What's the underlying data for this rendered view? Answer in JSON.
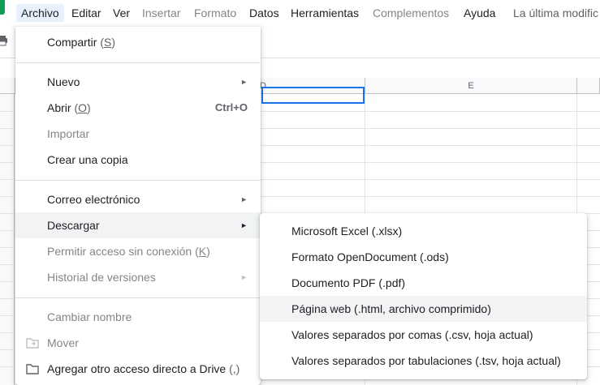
{
  "menubar": {
    "items": [
      {
        "label": "Archivo",
        "state": "active"
      },
      {
        "label": "Editar",
        "state": "normal"
      },
      {
        "label": "Ver",
        "state": "normal"
      },
      {
        "label": "Insertar",
        "state": "disabled"
      },
      {
        "label": "Formato",
        "state": "disabled"
      },
      {
        "label": "Datos",
        "state": "normal"
      },
      {
        "label": "Herramientas",
        "state": "normal"
      },
      {
        "label": "Complementos",
        "state": "disabled"
      },
      {
        "label": "Ayuda",
        "state": "normal"
      }
    ],
    "last_edit": "La última modific"
  },
  "grid": {
    "columns": [
      "D",
      "E"
    ]
  },
  "file_menu": {
    "share": {
      "label": "Compartir",
      "key": "S"
    },
    "new": {
      "label": "Nuevo"
    },
    "open": {
      "label": "Abrir",
      "key": "O",
      "shortcut": "Ctrl+O"
    },
    "import": {
      "label": "Importar"
    },
    "copy": {
      "label": "Crear una copia"
    },
    "email": {
      "label": "Correo electrónico"
    },
    "download": {
      "label": "Descargar"
    },
    "offline": {
      "label": "Permitir acceso sin conexión",
      "key": "K"
    },
    "history": {
      "label": "Historial de versiones"
    },
    "rename": {
      "label": "Cambiar nombre"
    },
    "move": {
      "label": "Mover"
    },
    "shortcut_drive": {
      "label": "Agregar otro acceso directo a Drive",
      "key": ","
    }
  },
  "download_menu": {
    "items": [
      {
        "label": "Microsoft Excel (.xlsx)"
      },
      {
        "label": "Formato OpenDocument (.ods)"
      },
      {
        "label": "Documento PDF (.pdf)"
      },
      {
        "label": "Página web (.html, archivo comprimido)"
      },
      {
        "label": "Valores separados por comas (.csv, hoja actual)"
      },
      {
        "label": "Valores separados por tabulaciones (.tsv, hoja actual)"
      }
    ]
  },
  "colors": {
    "accent": "#1a73e8",
    "active_menu_bg": "#e8f0fe",
    "hover_bg": "#f1f3f4",
    "disabled_text": "#80868b"
  }
}
